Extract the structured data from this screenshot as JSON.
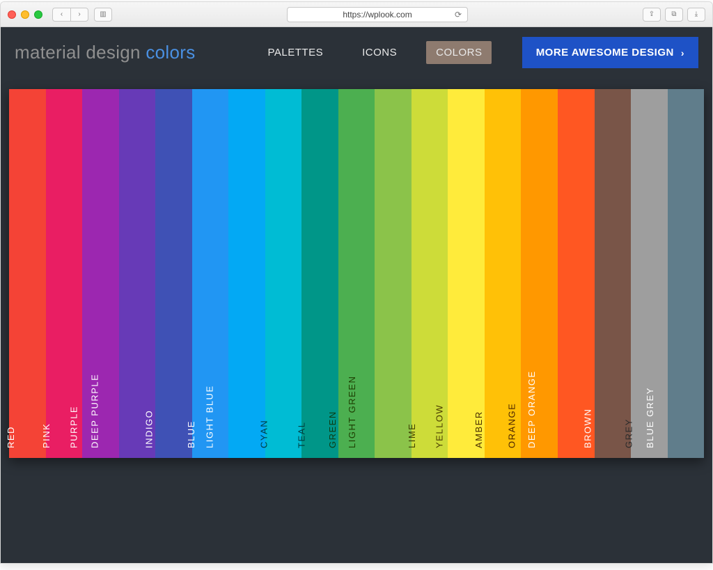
{
  "browser": {
    "url": "https://wplook.com"
  },
  "logo": {
    "part1": "material design",
    "part2": "colors"
  },
  "nav": {
    "items": [
      {
        "label": "PALETTES",
        "active": false
      },
      {
        "label": "ICONS",
        "active": false
      },
      {
        "label": "COLORS",
        "active": true
      }
    ]
  },
  "cta": {
    "label": "MORE AWESOME DESIGN"
  },
  "colors": [
    {
      "name": "RED",
      "hex": "#f44336",
      "text": "#ffffff"
    },
    {
      "name": "PINK",
      "hex": "#e91e63",
      "text": "#ffffff"
    },
    {
      "name": "PURPLE",
      "hex": "#9c27b0",
      "text": "#ffffff"
    },
    {
      "name": "DEEP PURPLE",
      "hex": "#673ab7",
      "text": "#ffffff"
    },
    {
      "name": "INDIGO",
      "hex": "#3f51b5",
      "text": "#ffffff"
    },
    {
      "name": "BLUE",
      "hex": "#2196f3",
      "text": "#ffffff"
    },
    {
      "name": "LIGHT BLUE",
      "hex": "#03a9f4",
      "text": "#ffffff"
    },
    {
      "name": "CYAN",
      "hex": "#00bcd4",
      "text": "#003c3f"
    },
    {
      "name": "TEAL",
      "hex": "#009688",
      "text": "#003c3f"
    },
    {
      "name": "GREEN",
      "hex": "#4caf50",
      "text": "#0d3b13"
    },
    {
      "name": "LIGHT GREEN",
      "hex": "#8bc34a",
      "text": "#1d3d00"
    },
    {
      "name": "LIME",
      "hex": "#cddc39",
      "text": "#3d3d00"
    },
    {
      "name": "YELLOW",
      "hex": "#ffeb3b",
      "text": "#4a3c00"
    },
    {
      "name": "AMBER",
      "hex": "#ffc107",
      "text": "#4a2e00"
    },
    {
      "name": "ORANGE",
      "hex": "#ff9800",
      "text": "#4a2500"
    },
    {
      "name": "DEEP ORANGE",
      "hex": "#ff5722",
      "text": "#ffffff"
    },
    {
      "name": "BROWN",
      "hex": "#795548",
      "text": "#ffffff"
    },
    {
      "name": "GREY",
      "hex": "#9e9e9e",
      "text": "#2b2b2b"
    },
    {
      "name": "BLUE GREY",
      "hex": "#607d8b",
      "text": "#ffffff"
    }
  ]
}
